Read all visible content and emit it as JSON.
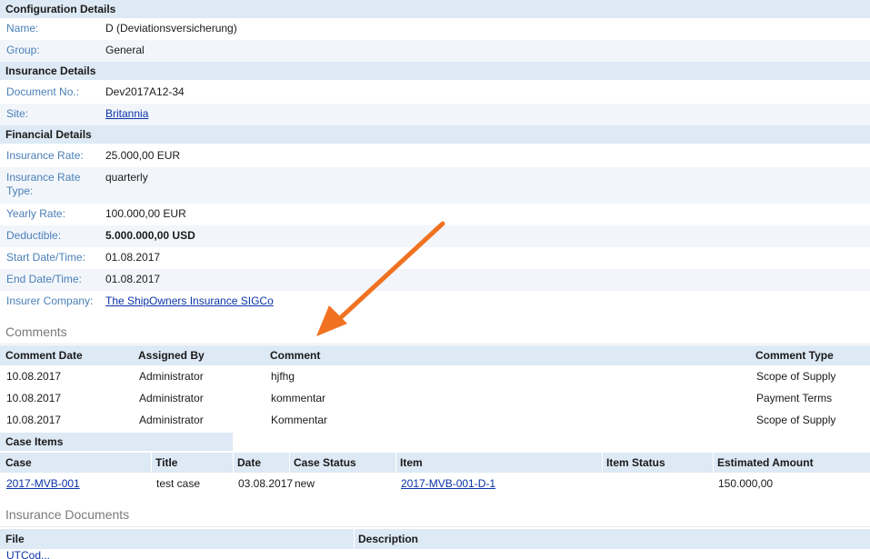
{
  "config": {
    "header": "Configuration Details",
    "name_label": "Name:",
    "name_value": "D (Deviationsversicherung)",
    "group_label": "Group:",
    "group_value": "General"
  },
  "insurance": {
    "header": "Insurance Details",
    "docno_label": "Document No.:",
    "docno_value": "Dev2017A12-34",
    "site_label": "Site:",
    "site_value": "Britannia"
  },
  "financial": {
    "header": "Financial Details",
    "rate_label": "Insurance Rate:",
    "rate_value": "25.000,00 EUR",
    "ratetype_label": "Insurance Rate Type:",
    "ratetype_value": "quarterly",
    "yearly_label": "Yearly Rate:",
    "yearly_value": "100.000,00 EUR",
    "deductible_label": "Deductible:",
    "deductible_value": "5.000.000,00 USD",
    "start_label": "Start Date/Time:",
    "start_value": "01.08.2017",
    "end_label": "End Date/Time:",
    "end_value": "01.08.2017",
    "insurer_label": "Insurer Company:",
    "insurer_value": "The ShipOwners Insurance SIGCo"
  },
  "comments": {
    "title": "Comments",
    "columns": [
      "Comment Date",
      "Assigned By",
      "Comment",
      "Comment Type"
    ],
    "rows": [
      [
        "10.08.2017",
        "Administrator",
        "hjfhg",
        "Scope of Supply"
      ],
      [
        "10.08.2017",
        "Administrator",
        "kommentar",
        "Payment Terms"
      ],
      [
        "10.08.2017",
        "Administrator",
        "Kommentar",
        "Scope of Supply"
      ]
    ]
  },
  "case_items": {
    "tab": "Case Items",
    "columns": [
      "Case",
      "Title",
      "Date",
      "Case Status",
      "Item",
      "Item Status",
      "Estimated Amount"
    ],
    "rows": [
      [
        "2017-MVB-001",
        "test case",
        "03.08.2017",
        "new",
        "2017-MVB-001-D-1",
        "",
        "150.000,00"
      ]
    ]
  },
  "documents": {
    "title": "Insurance Documents",
    "columns": [
      "File",
      "Description"
    ],
    "first_file": "UTCod..."
  },
  "colors": {
    "accent_arrow": "#f07221",
    "header_bg": "#dde9f5",
    "label_blue": "#4a7fb8",
    "link": "#0b33a8"
  }
}
